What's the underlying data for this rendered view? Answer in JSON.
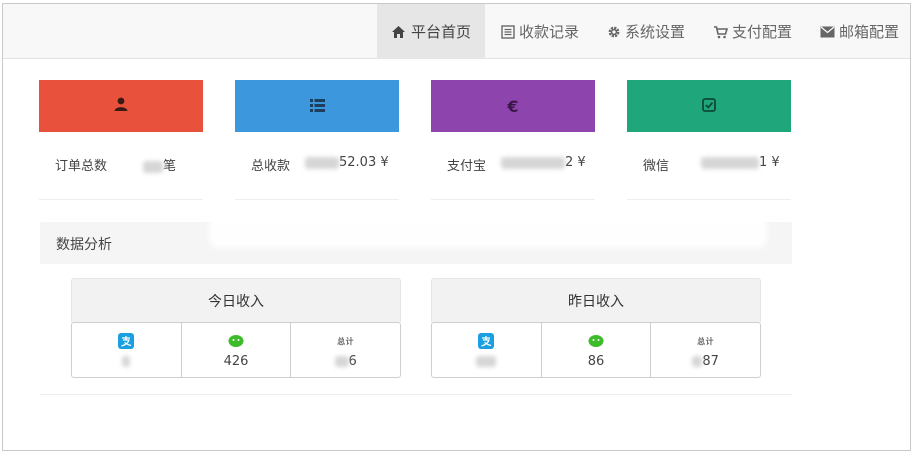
{
  "nav": {
    "items": [
      {
        "label": "平台首页",
        "icon": "home-icon",
        "active": true
      },
      {
        "label": "收款记录",
        "icon": "list-icon"
      },
      {
        "label": "系统设置",
        "icon": "gear-icon"
      },
      {
        "label": "支付配置",
        "icon": "cart-icon"
      },
      {
        "label": "邮箱配置",
        "icon": "envelope-icon"
      }
    ]
  },
  "cards": [
    {
      "label": "订单总数",
      "icon": "user-icon",
      "color": "#e8513b",
      "value_visible": "笔"
    },
    {
      "label": "总收款",
      "icon": "list-icon",
      "color": "#3d97dd",
      "value_visible": "52.03 ¥"
    },
    {
      "label": "支付宝",
      "icon": "euro-icon",
      "color": "#8e44ad",
      "value_visible": "2 ¥"
    },
    {
      "label": "微信",
      "icon": "check-square-icon",
      "color": "#1fa67a",
      "value_visible": "1 ¥"
    }
  ],
  "analysis": {
    "title": "数据分析"
  },
  "today": {
    "title": "今日收入",
    "cells": [
      {
        "icon": "alipay-icon",
        "value": ""
      },
      {
        "icon": "wechat-icon",
        "value": "426"
      },
      {
        "icon": "total-icon",
        "icon_text": "总计",
        "value_visible": "6"
      }
    ]
  },
  "yesterday": {
    "title": "昨日收入",
    "cells": [
      {
        "icon": "alipay-icon",
        "value": ""
      },
      {
        "icon": "wechat-icon",
        "value": "86"
      },
      {
        "icon": "total-icon",
        "icon_text": "总计",
        "value_visible": "87"
      }
    ]
  },
  "colors": {
    "alipay": "#1a9fe0",
    "wechat": "#3dbb2b"
  }
}
